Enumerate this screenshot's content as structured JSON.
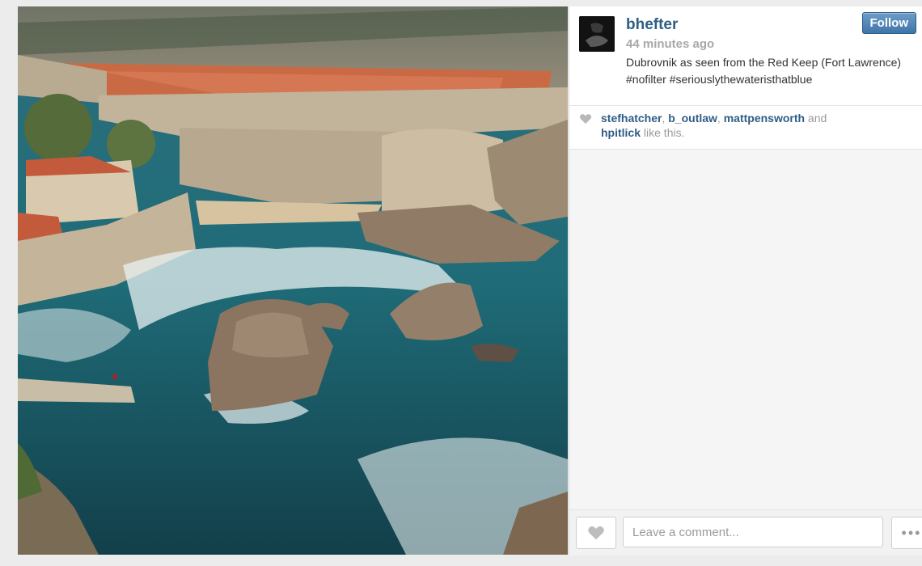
{
  "post": {
    "username": "bhefter",
    "time_ago": "44 minutes ago",
    "caption": "Dubrovnik as seen from the Red Keep (Fort Lawrence) #nofilter #seriouslythewateristhatblue",
    "follow_label": "Follow",
    "photo_icon": "photo"
  },
  "likes": {
    "users": [
      "stefhatcher",
      "b_outlaw",
      "mattpensworth",
      "hpitlick"
    ],
    "sep1": ", ",
    "sep2": ", ",
    "and_text": " and",
    "suffix": " like this.",
    "icon": "heart-icon"
  },
  "comment": {
    "placeholder": "Leave a comment...",
    "more_label": "•••"
  },
  "colors": {
    "link": "#2f5d86",
    "follow_button": "#4a7fb0",
    "muted": "#9a9a9a"
  }
}
